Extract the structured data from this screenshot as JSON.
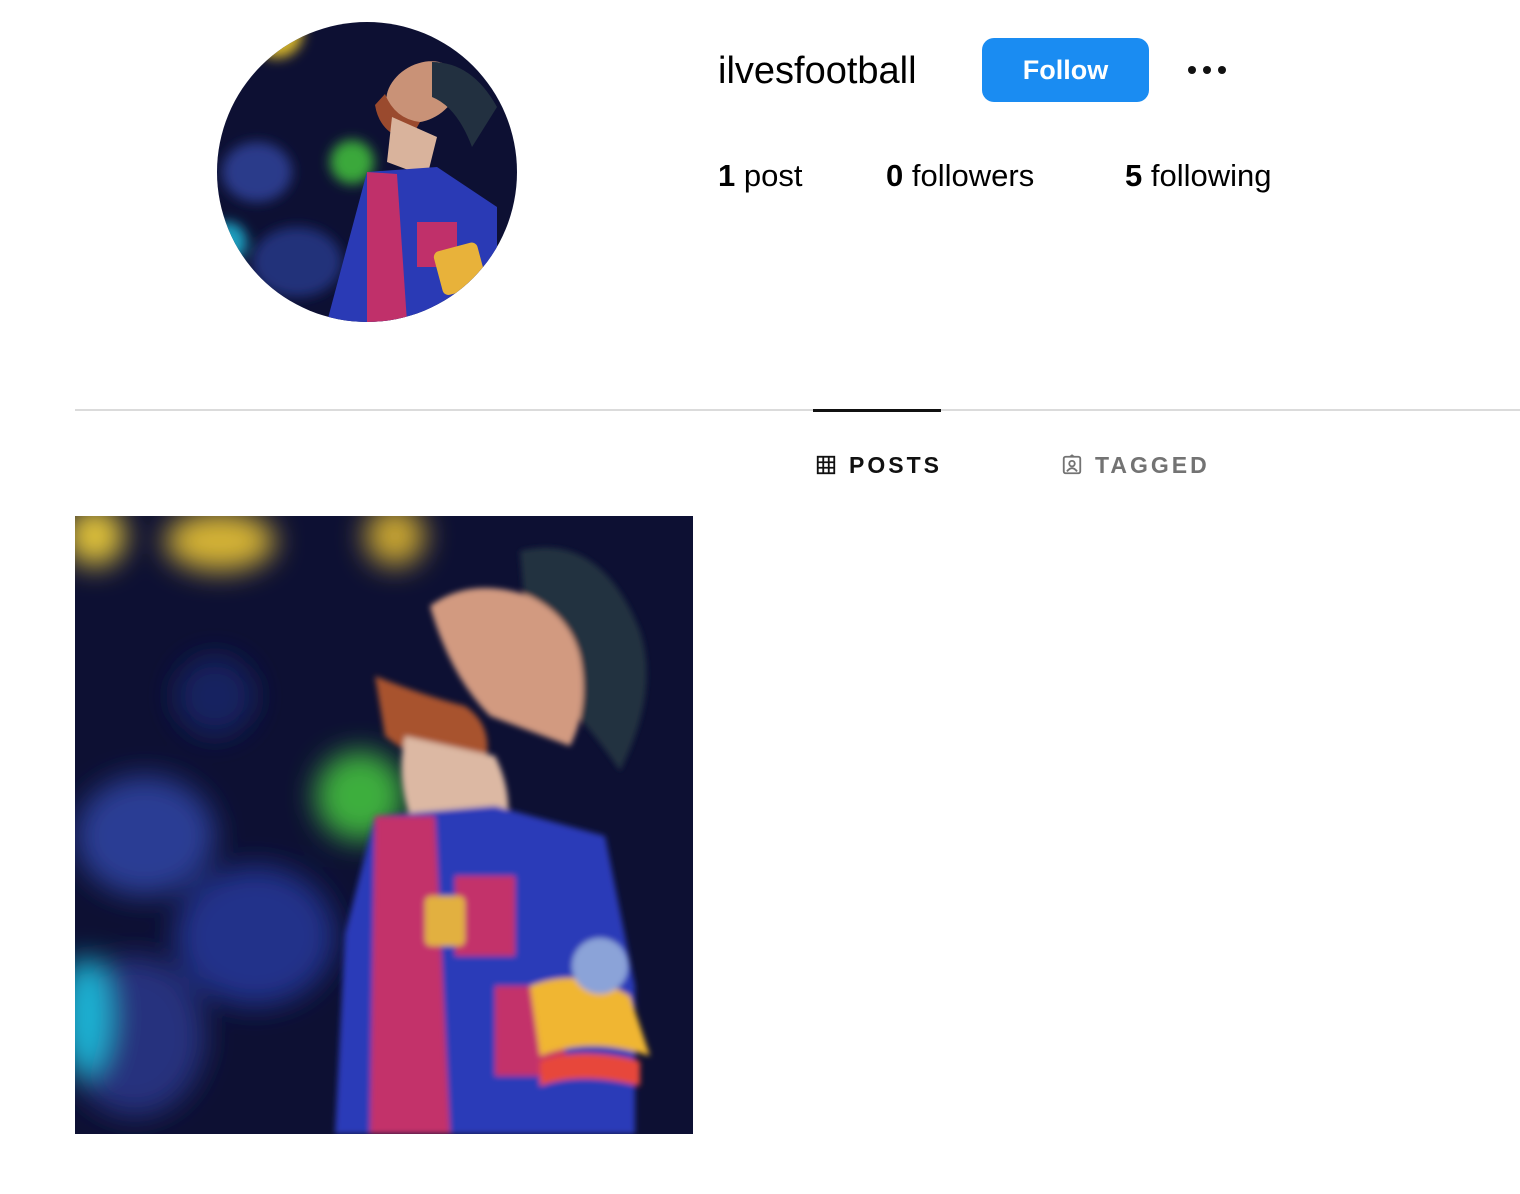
{
  "profile": {
    "username": "ilvesfootball",
    "follow_label": "Follow",
    "more_icon": "more-horizontal-icon"
  },
  "stats": {
    "posts_count": "1",
    "posts_label": "post",
    "followers_count": "0",
    "followers_label": "followers",
    "following_count": "5",
    "following_label": "following"
  },
  "tabs": [
    {
      "label": "POSTS",
      "icon": "grid-icon",
      "active": true
    },
    {
      "label": "TAGGED",
      "icon": "tagged-user-icon",
      "active": false
    }
  ],
  "colors": {
    "follow_button": "#1a8cf2",
    "divider": "#dbdbdb",
    "inactive_tab": "#737373"
  },
  "posts": [
    {
      "alt": "player photo"
    }
  ]
}
